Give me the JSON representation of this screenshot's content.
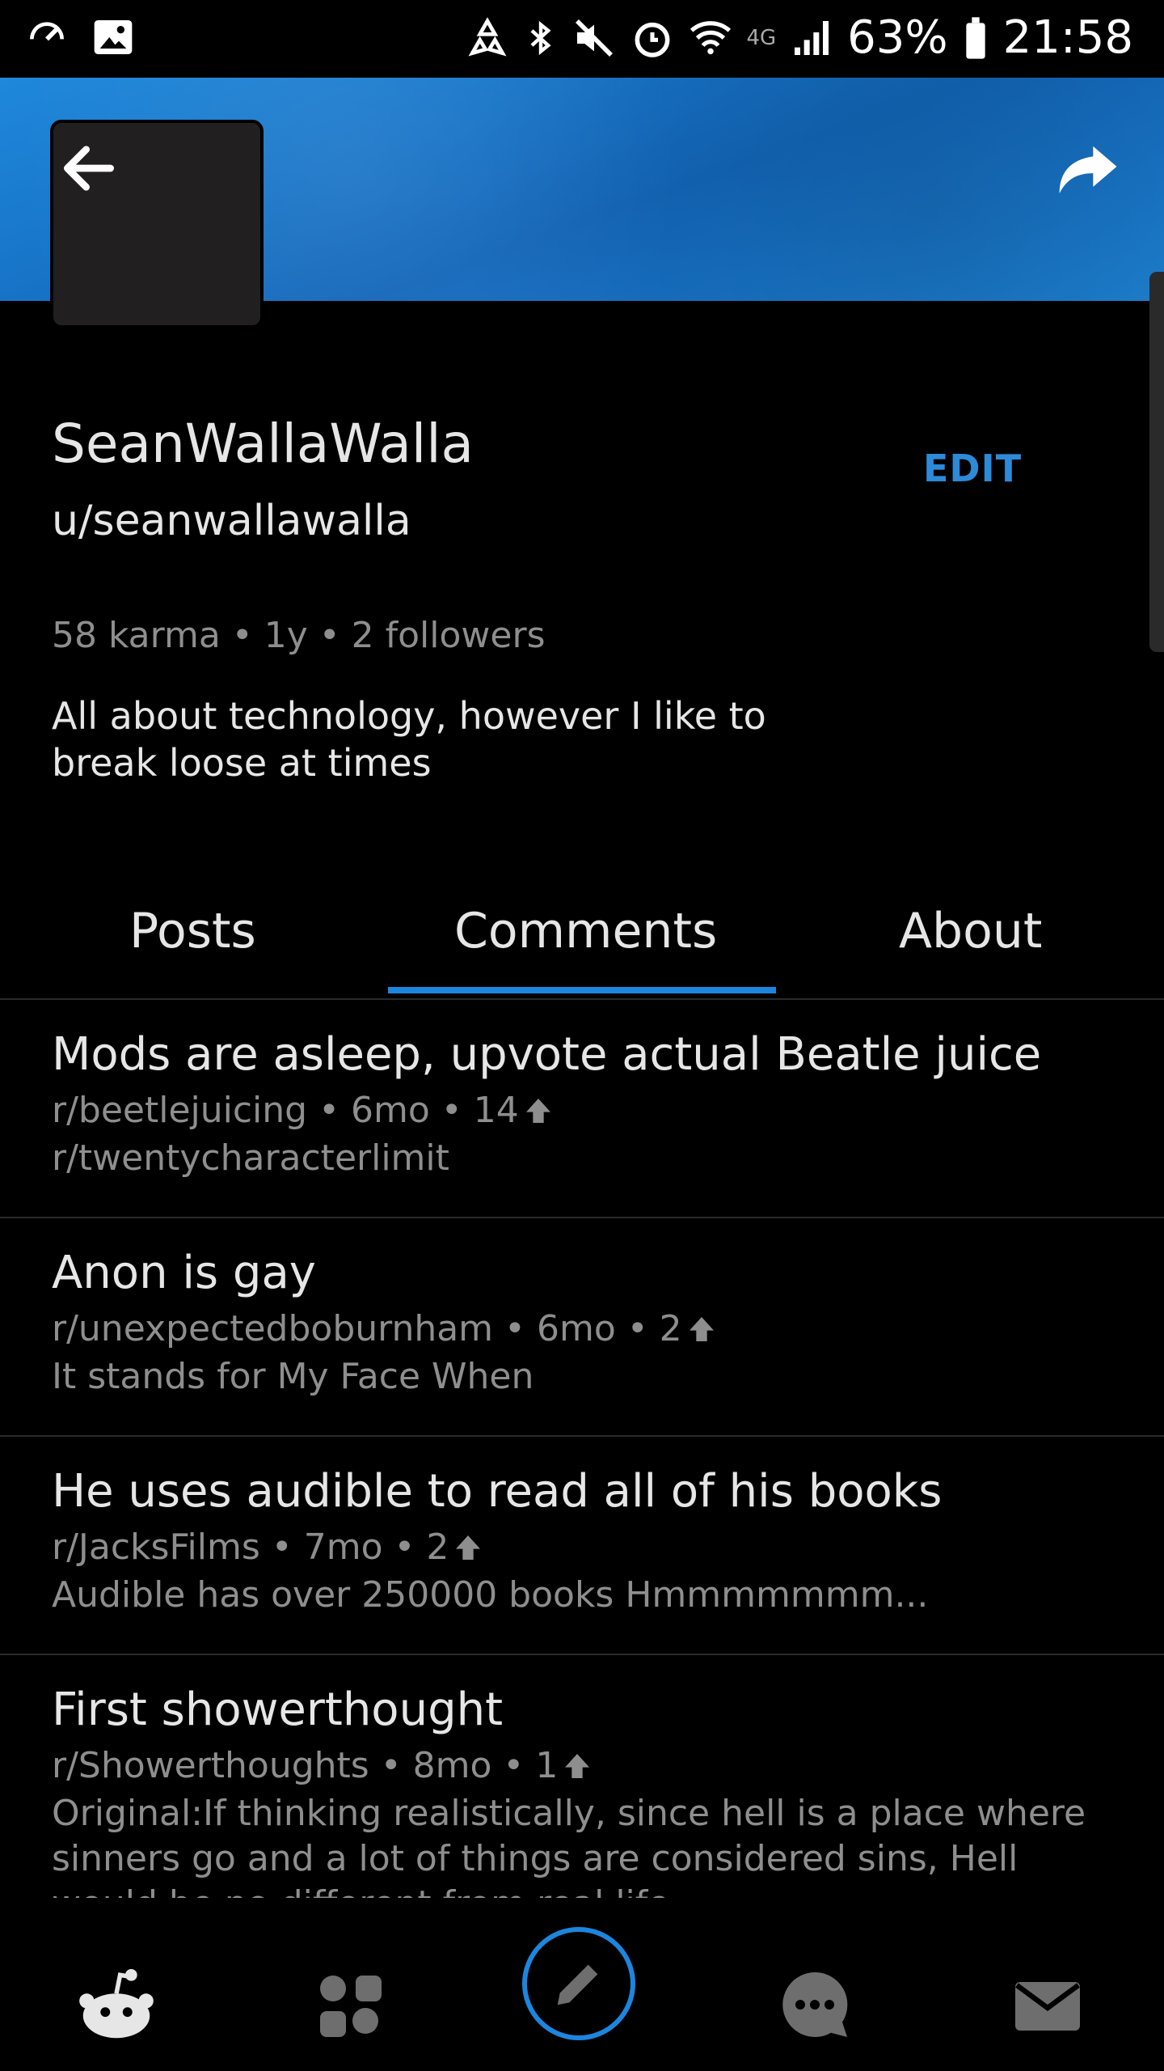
{
  "status_bar": {
    "battery": "63%",
    "time": "21:58",
    "network": "4G"
  },
  "profile": {
    "display_name": "SeanWallaWalla",
    "username": "u/seanwallawalla",
    "edit_label": "EDIT",
    "stats": "58 karma • 1y • 2 followers",
    "bio": "All about technology, however I like to break loose at times"
  },
  "tabs": [
    {
      "label": "Posts"
    },
    {
      "label": "Comments"
    },
    {
      "label": "About"
    }
  ],
  "comments": [
    {
      "title": "Mods are asleep, upvote actual Beatle juice",
      "meta": "r/beetlejuicing • 6mo • 14",
      "body": "r/twentycharacterlimit"
    },
    {
      "title": "Anon is gay",
      "meta": "r/unexpectedboburnham • 6mo • 2",
      "body": "It stands for My Face When"
    },
    {
      "title": "He uses audible to read all of his books",
      "meta": "r/JacksFilms • 7mo • 2",
      "body": "Audible has over 250000 books Hmmmmmmm..."
    },
    {
      "title": "First showerthought",
      "meta": "r/Showerthoughts • 8mo • 1",
      "body": "Original:If thinking realistically, since hell is a place where sinners go and a lot of things are considered sins, Hell would be no different from real life"
    }
  ],
  "colors": {
    "accent": "#1c86de",
    "banner": "#1e7fd2",
    "muted_text": "#8e8e8e"
  },
  "bottom_nav": [
    {
      "icon": "home-icon"
    },
    {
      "icon": "communities-icon"
    },
    {
      "icon": "pencil-icon"
    },
    {
      "icon": "chat-icon"
    },
    {
      "icon": "mail-icon"
    }
  ]
}
